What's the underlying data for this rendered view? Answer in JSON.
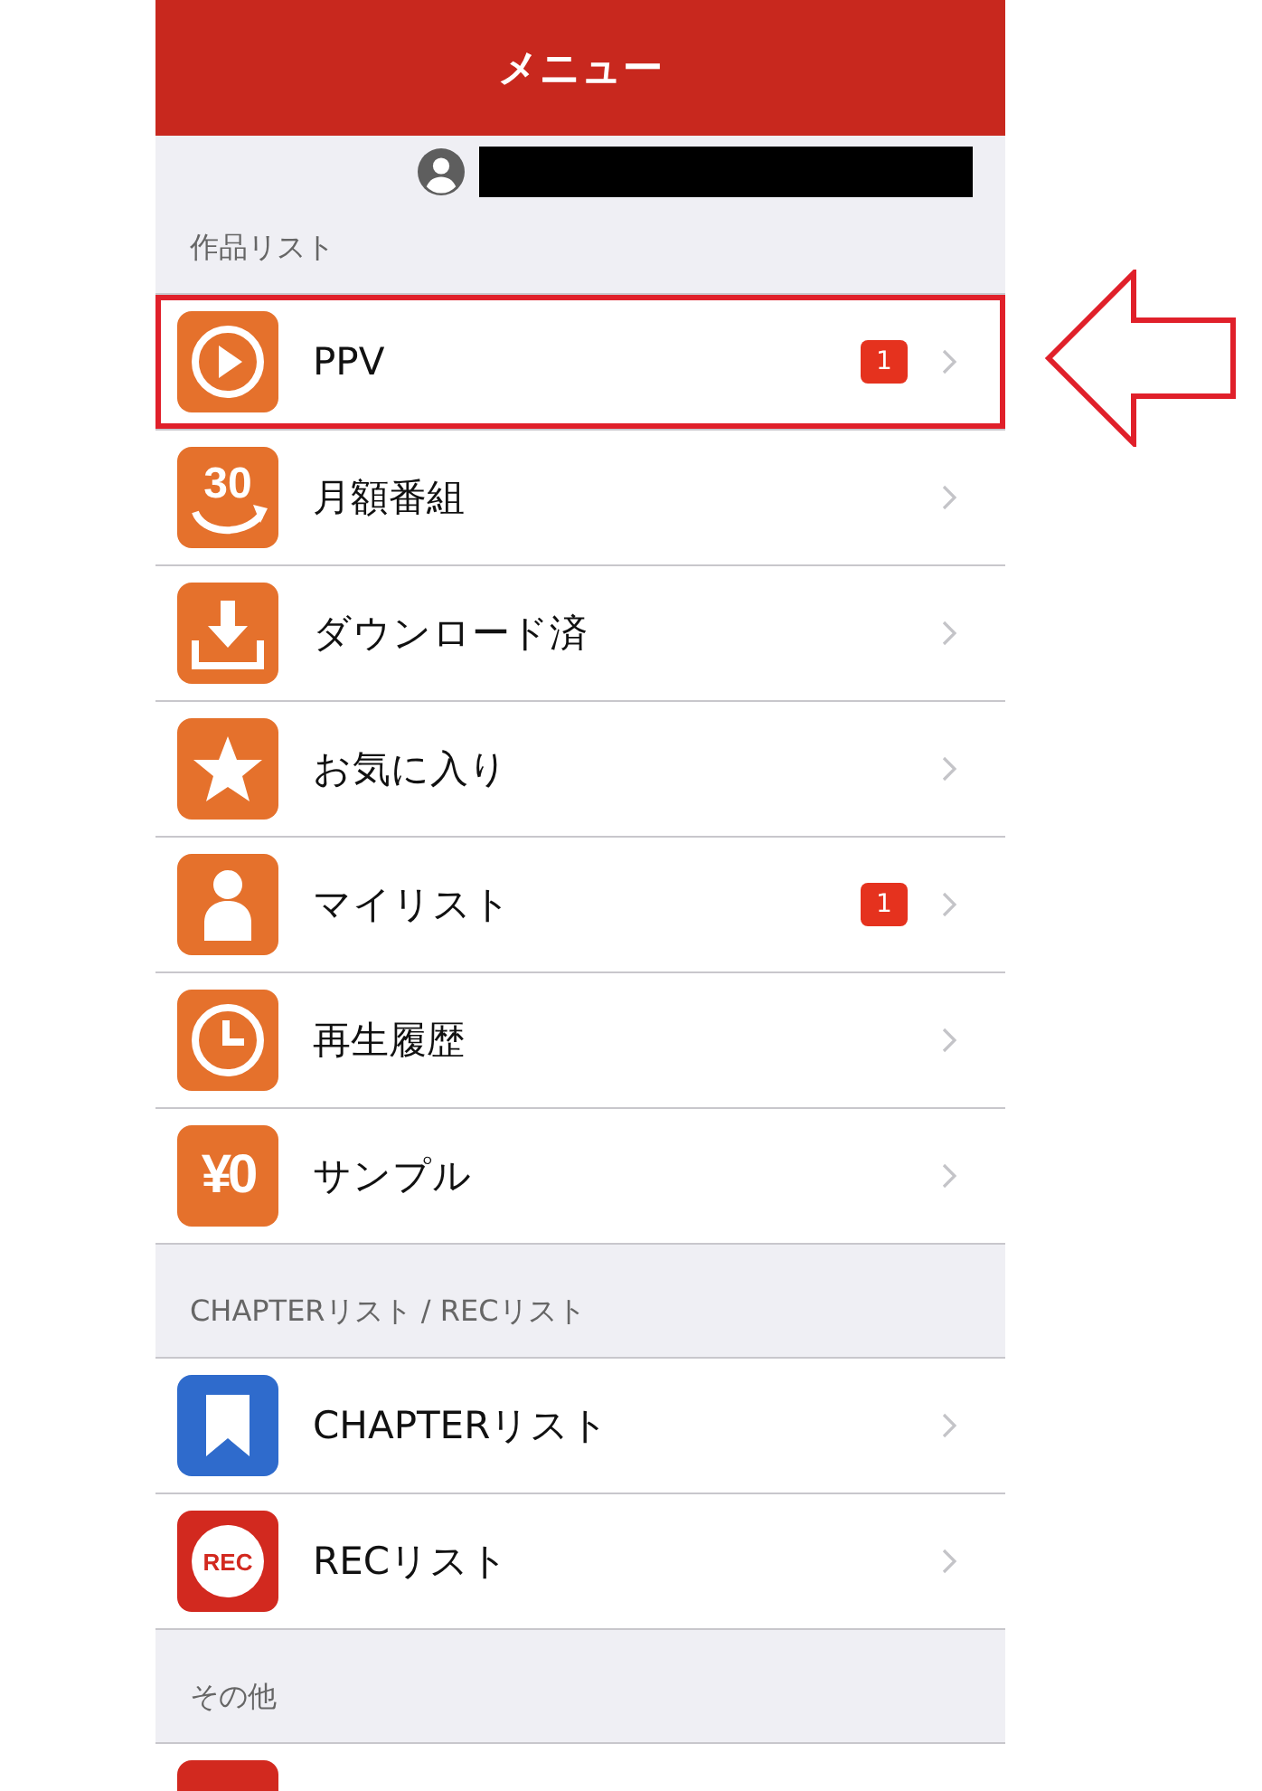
{
  "header": {
    "title": "メニュー"
  },
  "sections": [
    {
      "title": "作品リスト",
      "items": [
        {
          "label": "PPV",
          "kind": "play",
          "badge": "1",
          "highlighted": true
        },
        {
          "label": "月額番組",
          "kind": "thirty",
          "icon_text": "30",
          "highlighted": false
        },
        {
          "label": "ダウンロード済",
          "kind": "download",
          "highlighted": false
        },
        {
          "label": "お気に入り",
          "kind": "star",
          "highlighted": false
        },
        {
          "label": "マイリスト",
          "kind": "person",
          "badge": "1",
          "highlighted": false
        },
        {
          "label": "再生履歴",
          "kind": "clock",
          "highlighted": false
        },
        {
          "label": "サンプル",
          "kind": "yen",
          "icon_text": "¥0",
          "highlighted": false
        }
      ]
    },
    {
      "title": "CHAPTERリスト / RECリスト",
      "items": [
        {
          "label": "CHAPTERリスト",
          "kind": "bookmark",
          "highlighted": false
        },
        {
          "label": "RECリスト",
          "kind": "rec",
          "icon_text": "REC",
          "highlighted": false
        }
      ]
    },
    {
      "title": "その他",
      "items": [
        {
          "kind": "red",
          "highlighted": false
        }
      ]
    }
  ]
}
